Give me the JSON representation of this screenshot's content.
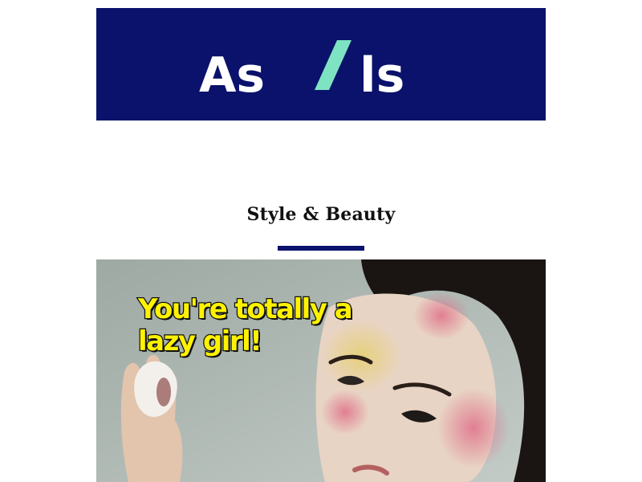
{
  "brand": {
    "logo_left": "As",
    "logo_right": "ls",
    "colors": {
      "navy": "#0b126b",
      "mint": "#7ee3c2",
      "caption_yellow": "#fff200"
    }
  },
  "section": {
    "title": "Style & Beauty"
  },
  "hero": {
    "caption_line1": "You're totally a",
    "caption_line2": "lazy girl!"
  }
}
